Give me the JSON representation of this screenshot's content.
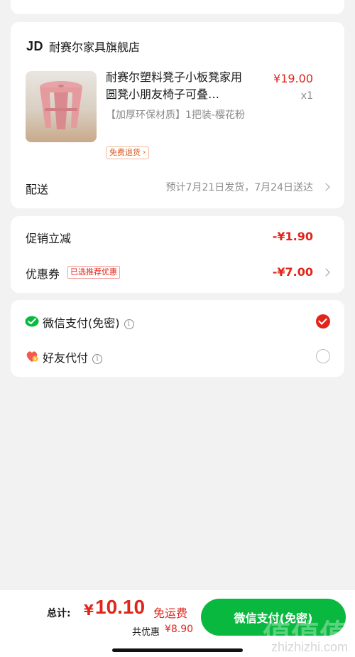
{
  "shop": {
    "logo": "JD",
    "name": "耐赛尔家具旗舰店"
  },
  "product": {
    "title": "耐赛尔塑料凳子小板凳家用圆凳小朋友椅子可叠…",
    "spec": "【加厚环保材质】1把装-樱花粉",
    "return_badge": "免费退货",
    "price": "¥19.00",
    "qty": "x1",
    "image": "pink-plastic-stool"
  },
  "delivery": {
    "label": "配送",
    "value": "预计7月21日发货，7月24日送达"
  },
  "promotion": {
    "label": "促销立减",
    "value": "-¥1.90"
  },
  "coupon": {
    "label": "优惠券",
    "tag": "已选推荐优惠",
    "value": "-¥7.00"
  },
  "payment": {
    "options": [
      {
        "label": "微信支付(免密)",
        "icon": "wechat-pay-icon",
        "selected": true
      },
      {
        "label": "好友代付",
        "icon": "friend-pay-icon",
        "selected": false
      }
    ]
  },
  "bottom": {
    "total_label": "总计:",
    "currency": "¥",
    "total": "10.10",
    "free_shipping": "免运费",
    "saved_label": "共优惠",
    "saved_amount": "¥8.90",
    "pay_button": "微信支付(免密)"
  },
  "watermark": {
    "text": "值值值",
    "url": "zhizhizhi.com"
  },
  "colors": {
    "accent_red": "#e1251b",
    "wechat_green": "#09b83e",
    "background": "#f2f2f2"
  }
}
